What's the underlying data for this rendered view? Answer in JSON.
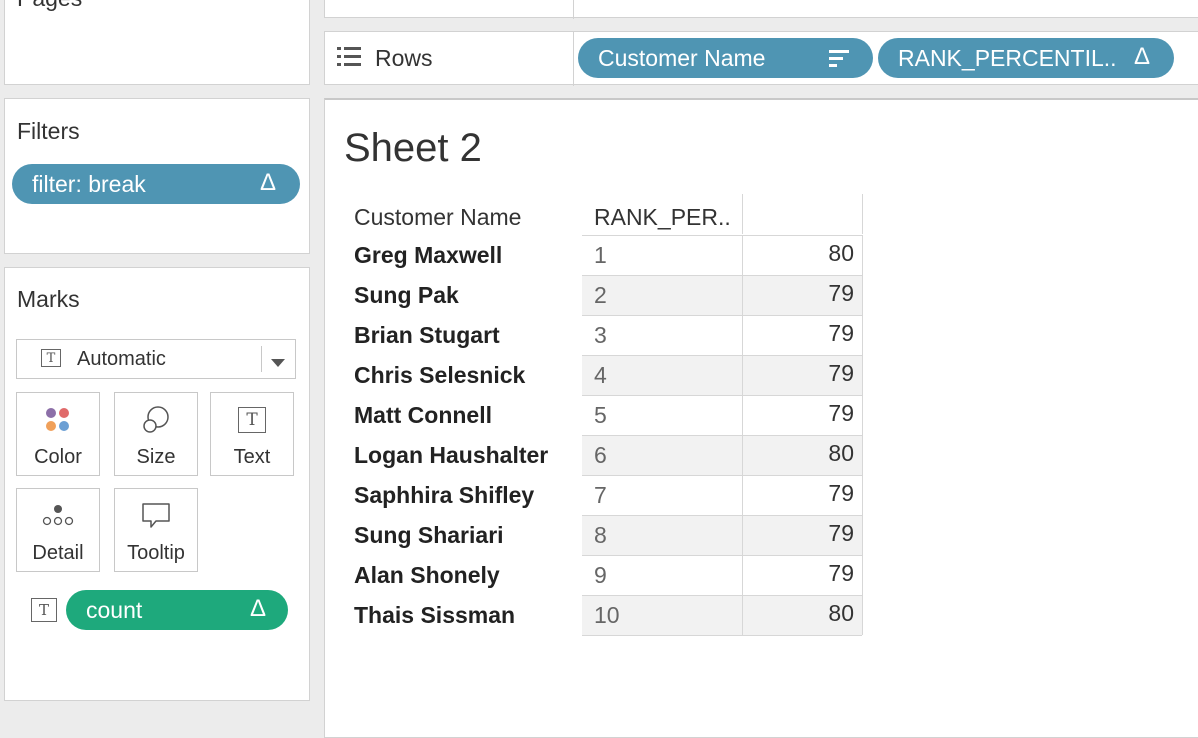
{
  "pages": {
    "title": "Pages"
  },
  "shelves": {
    "rows_label": "Rows",
    "pills": [
      {
        "label": "Customer Name"
      },
      {
        "label": "RANK_PERCENTIL.."
      }
    ]
  },
  "filters": {
    "title": "Filters",
    "pill": "filter: break"
  },
  "marks": {
    "title": "Marks",
    "type": "Automatic",
    "buttons": [
      "Color",
      "Size",
      "Text",
      "Detail",
      "Tooltip"
    ],
    "field_pill": "count"
  },
  "sheet": {
    "title": "Sheet 2",
    "headers": [
      "Customer Name",
      "RANK_PER..",
      ""
    ],
    "rows": [
      {
        "name": "Greg Maxwell",
        "rank": "1",
        "value": "80"
      },
      {
        "name": "Sung Pak",
        "rank": "2",
        "value": "79"
      },
      {
        "name": "Brian Stugart",
        "rank": "3",
        "value": "79"
      },
      {
        "name": "Chris Selesnick",
        "rank": "4",
        "value": "79"
      },
      {
        "name": "Matt Connell",
        "rank": "5",
        "value": "79"
      },
      {
        "name": "Logan Haushalter",
        "rank": "6",
        "value": "80"
      },
      {
        "name": "Saphhira Shifley",
        "rank": "7",
        "value": "79"
      },
      {
        "name": "Sung Shariari",
        "rank": "8",
        "value": "79"
      },
      {
        "name": "Alan Shonely",
        "rank": "9",
        "value": "79"
      },
      {
        "name": "Thais Sissman",
        "rank": "10",
        "value": "80"
      }
    ]
  },
  "colors": {
    "dimension_pill": "#4f95b3",
    "measure_pill": "#1ea97c"
  }
}
